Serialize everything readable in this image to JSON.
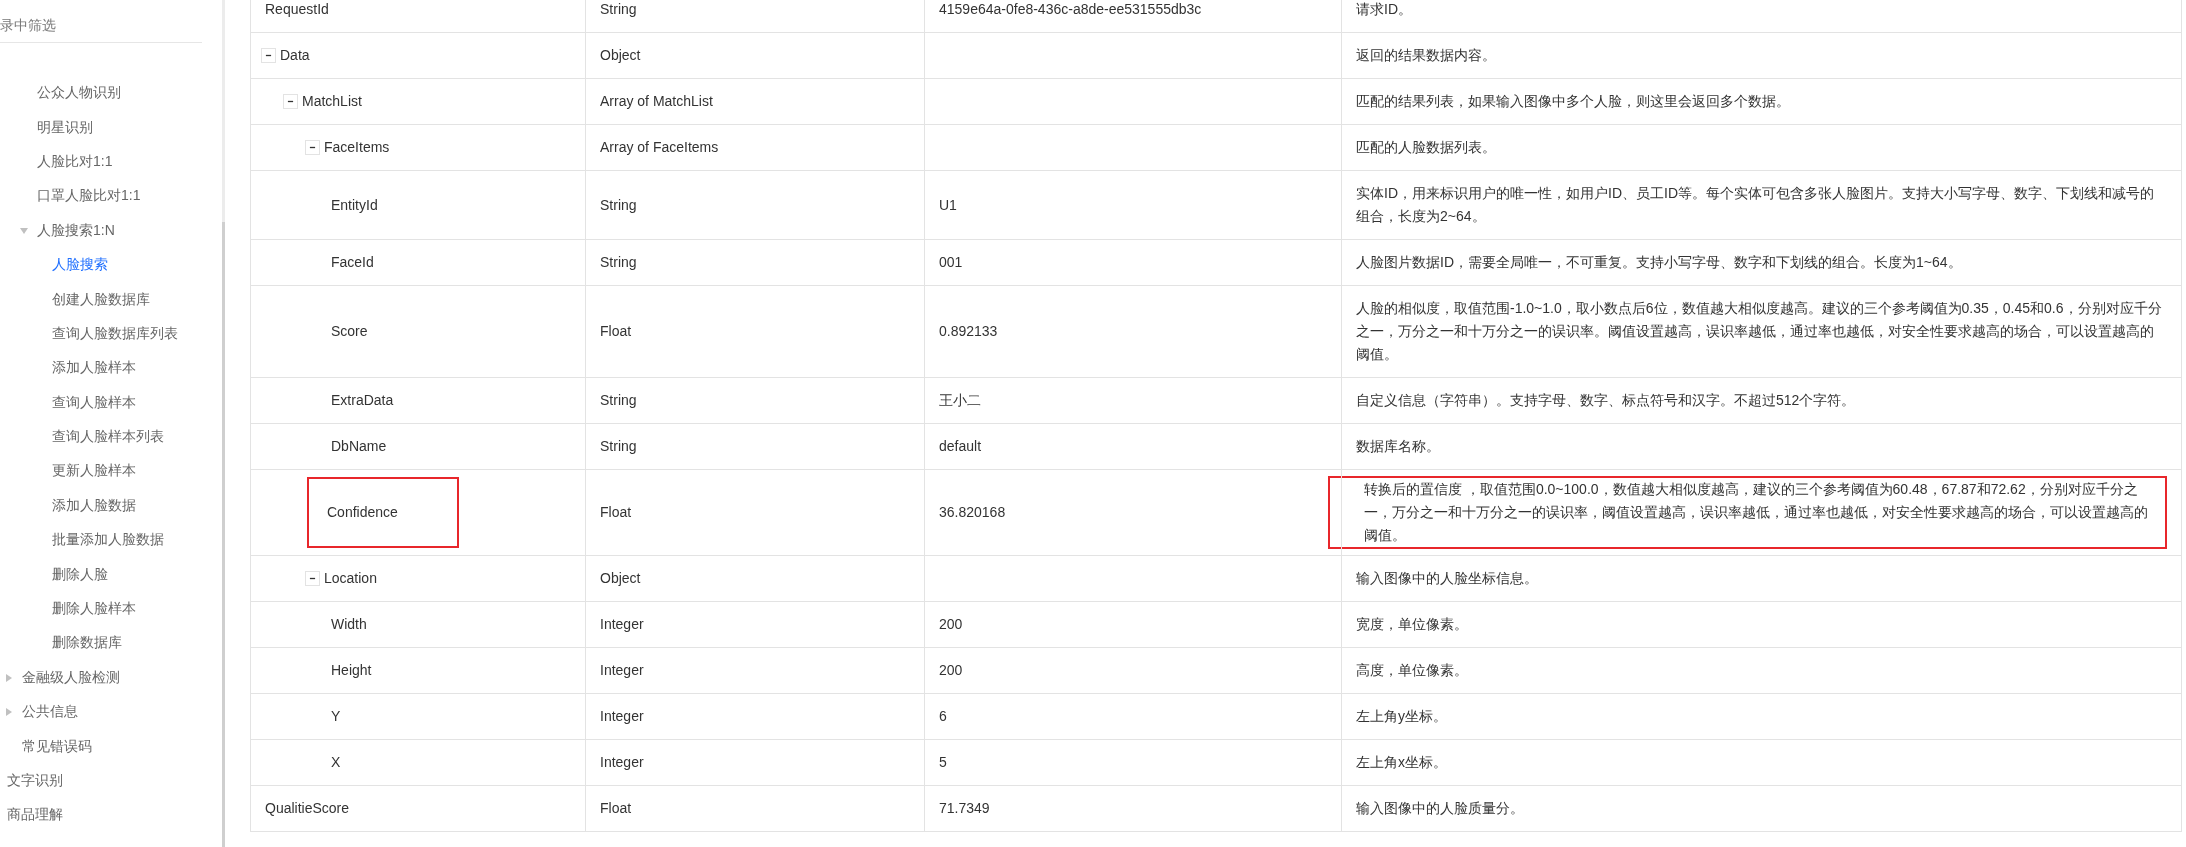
{
  "sidebar": {
    "filter_label": "录中筛选",
    "items": [
      {
        "children": [
          {
            "children": [
              {
                "label": "公众人物识别",
                "selected": false
              },
              {
                "label": "明星识别",
                "selected": false
              },
              {
                "label": "人脸比对1:1",
                "selected": false
              },
              {
                "label": "口罩人脸比对1:1",
                "selected": false
              },
              {
                "label": "人脸搜索1:N",
                "selected": false,
                "expanded": true,
                "children": [
                  {
                    "label": "人脸搜索",
                    "selected": true
                  },
                  {
                    "label": "创建人脸数据库",
                    "selected": false
                  },
                  {
                    "label": "查询人脸数据库列表",
                    "selected": false
                  },
                  {
                    "label": "添加人脸样本",
                    "selected": false
                  },
                  {
                    "label": "查询人脸样本",
                    "selected": false
                  },
                  {
                    "label": "查询人脸样本列表",
                    "selected": false
                  },
                  {
                    "label": "更新人脸样本",
                    "selected": false
                  },
                  {
                    "label": "添加人脸数据",
                    "selected": false
                  },
                  {
                    "label": "批量添加人脸数据",
                    "selected": false
                  },
                  {
                    "label": "删除人脸",
                    "selected": false
                  },
                  {
                    "label": "删除人脸样本",
                    "selected": false
                  },
                  {
                    "label": "删除数据库",
                    "selected": false
                  }
                ]
              }
            ]
          },
          {
            "label": "金融级人脸检测",
            "selected": false,
            "expanded": false
          },
          {
            "label": "公共信息",
            "selected": false,
            "expanded": false
          },
          {
            "label": "常见错误码",
            "selected": false
          }
        ]
      },
      {
        "label": "文字识别",
        "selected": false
      },
      {
        "label": "商品理解",
        "selected": false
      }
    ]
  },
  "table": {
    "rows": [
      {
        "name": "RequestId",
        "type": "String",
        "example": "4159e64a-0fe8-436c-a8de-ee531555db3c",
        "description": "请求ID。"
      },
      {
        "name": "Data",
        "type": "Object",
        "description": "返回的结果数据内容。",
        "expanded": true,
        "children": [
          {
            "name": "MatchList",
            "type": "Array of MatchList",
            "description": "匹配的结果列表，如果输入图像中多个人脸，则这里会返回多个数据。",
            "expanded": true,
            "children": [
              {
                "name": "FaceItems",
                "type": "Array of FaceItems",
                "description": "匹配的人脸数据列表。",
                "expanded": true,
                "children": [
                  {
                    "name": "EntityId",
                    "type": "String",
                    "example": "U1",
                    "description": "实体ID，用来标识用户的唯一性，如用户ID、员工ID等。每个实体可包含多张人脸图片。支持大小写字母、数字、下划线和减号的组合，长度为2~64。"
                  },
                  {
                    "name": "FaceId",
                    "type": "String",
                    "example": "001",
                    "description": "人脸图片数据ID，需要全局唯一，不可重复。支持小写字母、数字和下划线的组合。长度为1~64。"
                  },
                  {
                    "name": "Score",
                    "type": "Float",
                    "example": "0.892133",
                    "description": "人脸的相似度，取值范围-1.0~1.0，取小数点后6位，数值越大相似度越高。建议的三个参考阈值为0.35，0.45和0.6，分别对应千分之一，万分之一和十万分之一的误识率。阈值设置越高，误识率越低，通过率也越低，对安全性要求越高的场合，可以设置越高的阈值。"
                  },
                  {
                    "name": "ExtraData",
                    "type": "String",
                    "example": "王小二",
                    "description": "自定义信息（字符串）。支持字母、数字、标点符号和汉字。不超过512个字符。"
                  },
                  {
                    "name": "DbName",
                    "type": "String",
                    "example": "default",
                    "description": "数据库名称。"
                  },
                  {
                    "name": "Confidence",
                    "type": "Float",
                    "example": "36.820168",
                    "description": "转换后的置信度 ，取值范围0.0~100.0，数值越大相似度越高，建议的三个参考阈值为60.48，67.87和72.62，分别对应千分之一，万分之一和十万分之一的误识率，阈值设置越高，误识率越低，通过率也越低，对安全性要求越高的场合，可以设置越高的阈值。",
                    "highlighted": true
                  }
                ]
              },
              {
                "name": "Location",
                "type": "Object",
                "description": "输入图像中的人脸坐标信息。",
                "expanded": true,
                "children": [
                  {
                    "name": "Width",
                    "type": "Integer",
                    "example": "200",
                    "description": "宽度，单位像素。"
                  },
                  {
                    "name": "Height",
                    "type": "Integer",
                    "example": "200",
                    "description": "高度，单位像素。"
                  },
                  {
                    "name": "Y",
                    "type": "Integer",
                    "example": "6",
                    "description": "左上角y坐标。"
                  },
                  {
                    "name": "X",
                    "type": "Integer",
                    "example": "5",
                    "description": "左上角x坐标。"
                  }
                ]
              }
            ]
          }
        ]
      },
      {
        "name": "QualitieScore",
        "type": "Float",
        "example": "71.7349",
        "description": "输入图像中的人脸质量分。"
      }
    ]
  }
}
